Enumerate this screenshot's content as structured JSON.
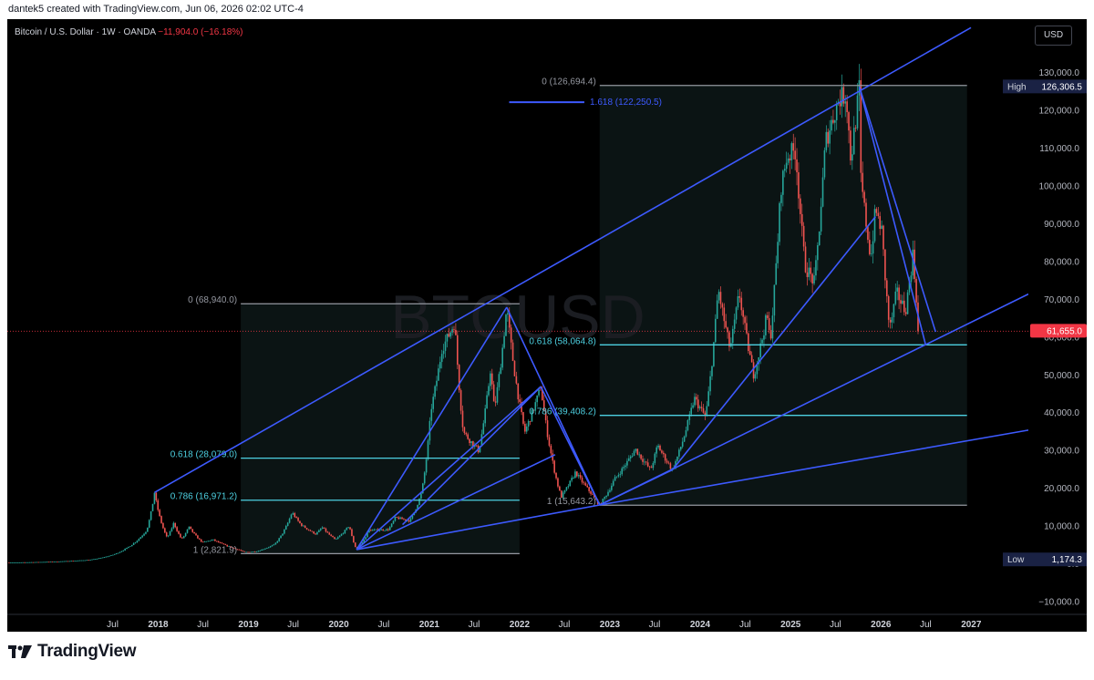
{
  "header": {
    "credit": "dantek5 created with TradingView.com, Jun 06, 2026 02:02 UTC-4"
  },
  "ticker": {
    "symbol": "Bitcoin / U.S. Dollar · 1W · OANDA",
    "change": "−11,904.0 (−16.18%)"
  },
  "currency_label": "USD",
  "watermark": "BTCUSD",
  "footer": {
    "logo_text": "TradingView",
    "logo_icon": "tradingview-logo-icon"
  },
  "colors": {
    "background": "#000000",
    "up": "#26a69a",
    "down": "#ef5350",
    "trendline": "#3d5afe",
    "fib_cyan": "#4dd0e1",
    "fib_gray": "#9598a1",
    "last_price": "#f23645"
  },
  "chart_data": {
    "type": "candlestick",
    "ylim": [
      -13000,
      137000
    ],
    "xlim": [
      "2016-05-01",
      "2027-08-20"
    ],
    "y_ticks": [
      -10000,
      0,
      10000,
      20000,
      30000,
      40000,
      50000,
      60000,
      70000,
      80000,
      90000,
      100000,
      110000,
      120000,
      130000
    ],
    "y_tick_labels": [
      "−10,000.0",
      "0.0",
      "10,000.0",
      "20,000.0",
      "30,000.0",
      "40,000.0",
      "50,000.0",
      "60,000.0",
      "70,000.0",
      "80,000.0",
      "90,000.0",
      "100,000.0",
      "110,000.0",
      "120,000.0",
      "130,000.0"
    ],
    "x_ticks": [
      {
        "date": "2017-07-01",
        "label": "Jul",
        "bold": false
      },
      {
        "date": "2018-01-01",
        "label": "2018",
        "bold": true
      },
      {
        "date": "2018-07-01",
        "label": "Jul",
        "bold": false
      },
      {
        "date": "2019-01-01",
        "label": "2019",
        "bold": true
      },
      {
        "date": "2019-07-01",
        "label": "Jul",
        "bold": false
      },
      {
        "date": "2020-01-01",
        "label": "2020",
        "bold": true
      },
      {
        "date": "2020-07-01",
        "label": "Jul",
        "bold": false
      },
      {
        "date": "2021-01-01",
        "label": "2021",
        "bold": true
      },
      {
        "date": "2021-07-01",
        "label": "Jul",
        "bold": false
      },
      {
        "date": "2022-01-01",
        "label": "2022",
        "bold": true
      },
      {
        "date": "2022-07-01",
        "label": "Jul",
        "bold": false
      },
      {
        "date": "2023-01-01",
        "label": "2023",
        "bold": true
      },
      {
        "date": "2023-07-01",
        "label": "Jul",
        "bold": false
      },
      {
        "date": "2024-01-01",
        "label": "2024",
        "bold": true
      },
      {
        "date": "2024-07-01",
        "label": "Jul",
        "bold": false
      },
      {
        "date": "2025-01-01",
        "label": "2025",
        "bold": true
      },
      {
        "date": "2025-07-01",
        "label": "Jul",
        "bold": false
      },
      {
        "date": "2026-01-01",
        "label": "2026",
        "bold": true
      },
      {
        "date": "2026-07-01",
        "label": "Jul",
        "bold": false
      },
      {
        "date": "2027-01-01",
        "label": "2027",
        "bold": true
      }
    ],
    "price_path": [
      [
        "2016-05-01",
        450
      ],
      [
        "2016-11-01",
        700
      ],
      [
        "2017-04-01",
        1200
      ],
      [
        "2017-07-01",
        2500
      ],
      [
        "2017-09-01",
        4500
      ],
      [
        "2017-11-15",
        9000
      ],
      [
        "2017-12-17",
        19000
      ],
      [
        "2018-02-06",
        7000
      ],
      [
        "2018-03-05",
        11000
      ],
      [
        "2018-04-06",
        6600
      ],
      [
        "2018-05-05",
        9900
      ],
      [
        "2018-06-29",
        5800
      ],
      [
        "2018-08-10",
        6500
      ],
      [
        "2018-11-25",
        3800
      ],
      [
        "2018-12-15",
        3200
      ],
      [
        "2019-02-01",
        3400
      ],
      [
        "2019-04-15",
        5200
      ],
      [
        "2019-06-26",
        13800
      ],
      [
        "2019-08-01",
        10500
      ],
      [
        "2019-09-30",
        8000
      ],
      [
        "2019-10-26",
        9800
      ],
      [
        "2019-12-18",
        6500
      ],
      [
        "2020-02-13",
        10300
      ],
      [
        "2020-03-13",
        3900
      ],
      [
        "2020-05-01",
        9000
      ],
      [
        "2020-07-20",
        9200
      ],
      [
        "2020-08-17",
        12400
      ],
      [
        "2020-10-15",
        11500
      ],
      [
        "2020-12-01",
        19000
      ],
      [
        "2021-01-08",
        41000
      ],
      [
        "2021-02-21",
        57000
      ],
      [
        "2021-04-14",
        64000
      ],
      [
        "2021-05-19",
        35000
      ],
      [
        "2021-07-20",
        30000
      ],
      [
        "2021-09-06",
        52000
      ],
      [
        "2021-09-21",
        41000
      ],
      [
        "2021-11-10",
        68000
      ],
      [
        "2022-01-22",
        35000
      ],
      [
        "2022-03-28",
        47000
      ],
      [
        "2022-05-12",
        28000
      ],
      [
        "2022-06-18",
        17800
      ],
      [
        "2022-08-15",
        24400
      ],
      [
        "2022-10-15",
        19000
      ],
      [
        "2022-11-21",
        15700
      ],
      [
        "2023-01-20",
        22500
      ],
      [
        "2023-04-14",
        30500
      ],
      [
        "2023-06-15",
        25000
      ],
      [
        "2023-07-13",
        31500
      ],
      [
        "2023-09-11",
        25000
      ],
      [
        "2023-12-08",
        44000
      ],
      [
        "2024-01-23",
        39000
      ],
      [
        "2024-03-14",
        73000
      ],
      [
        "2024-05-01",
        57000
      ],
      [
        "2024-06-07",
        71900
      ],
      [
        "2024-08-05",
        50000
      ],
      [
        "2024-09-27",
        66000
      ],
      [
        "2024-10-10",
        59000
      ],
      [
        "2024-11-22",
        99500
      ],
      [
        "2024-12-17",
        108000
      ],
      [
        "2025-01-21",
        109500
      ],
      [
        "2025-02-28",
        79000
      ],
      [
        "2025-04-07",
        74500
      ],
      [
        "2025-05-22",
        112000
      ],
      [
        "2025-07-14",
        123000
      ],
      [
        "2025-08-14",
        124500
      ],
      [
        "2025-09-01",
        107000
      ],
      [
        "2025-10-06",
        126300
      ],
      [
        "2025-10-10",
        103000
      ],
      [
        "2025-11-21",
        81000
      ],
      [
        "2025-12-10",
        94000
      ],
      [
        "2026-01-05",
        88000
      ],
      [
        "2026-02-05",
        62000
      ],
      [
        "2026-03-05",
        72000
      ],
      [
        "2026-04-10",
        67000
      ],
      [
        "2026-05-10",
        82000
      ],
      [
        "2026-06-06",
        61655
      ]
    ],
    "fib_levels": [
      {
        "label": "0 (68,940.0)",
        "price": 68940,
        "color": "gray",
        "from": "2018-12-01",
        "to": "2022-01-01",
        "label_side": "left"
      },
      {
        "label": "0.618 (28,079.0)",
        "price": 28079,
        "color": "cyan",
        "from": "2018-12-01",
        "to": "2022-01-01",
        "label_side": "left"
      },
      {
        "label": "0.786 (16,971.2)",
        "price": 16971,
        "color": "cyan",
        "from": "2018-12-01",
        "to": "2022-01-01",
        "label_side": "left"
      },
      {
        "label": "1 (2,821.9)",
        "price": 2822,
        "color": "gray",
        "from": "2018-12-01",
        "to": "2022-01-01",
        "label_side": "left"
      },
      {
        "label": "0 (126,694.4)",
        "price": 126694,
        "color": "gray",
        "from": "2022-11-21",
        "to": "2026-12-15",
        "label_side": "left"
      },
      {
        "label": "1.618 (122,250.5)",
        "price": 122250,
        "color": "blue",
        "from": "2021-11-20",
        "to": "2022-09-20",
        "label_side": "right"
      },
      {
        "label": "0.618 (58,064.8)",
        "price": 58065,
        "color": "cyan",
        "from": "2022-11-21",
        "to": "2026-12-15",
        "label_side": "left"
      },
      {
        "label": "0.786 (39,408.2)",
        "price": 39408,
        "color": "cyan",
        "from": "2022-11-21",
        "to": "2026-12-15",
        "label_side": "left"
      },
      {
        "label": "1 (15,643.2)",
        "price": 15643,
        "color": "gray",
        "from": "2022-11-21",
        "to": "2026-12-15",
        "label_side": "left"
      }
    ],
    "trendlines": [
      {
        "from": [
          "2017-12-17",
          19000
        ],
        "to": [
          "2026-12-31",
          142000
        ]
      },
      {
        "from": [
          "2020-03-13",
          3900
        ],
        "to": [
          "2021-11-10",
          68000
        ]
      },
      {
        "from": [
          "2020-03-13",
          3900
        ],
        "to": [
          "2022-11-21",
          15700
        ]
      },
      {
        "from": [
          "2020-03-13",
          3900
        ],
        "to": [
          "2022-05-25",
          29000
        ]
      },
      {
        "from": [
          "2020-03-13",
          3900
        ],
        "to": [
          "2022-03-28",
          47000
        ]
      },
      {
        "from": [
          "2020-09-15",
          10500
        ],
        "to": [
          "2022-03-28",
          47000
        ]
      },
      {
        "from": [
          "2021-11-10",
          68000
        ],
        "to": [
          "2022-11-21",
          15700
        ]
      },
      {
        "from": [
          "2022-03-28",
          47000
        ],
        "to": [
          "2022-11-21",
          15700
        ]
      },
      {
        "from": [
          "2022-11-21",
          15700
        ],
        "to": [
          "2023-09-11",
          25000
        ]
      },
      {
        "from": [
          "2023-09-11",
          25000
        ],
        "to": [
          "2025-12-10",
          92000
        ]
      },
      {
        "from": [
          "2022-11-21",
          15700
        ],
        "to": [
          "2027-08-20",
          71500
        ]
      },
      {
        "from": [
          "2022-11-21",
          15700
        ],
        "to": [
          "2027-08-20",
          35500
        ]
      },
      {
        "from": [
          "2025-10-06",
          126300
        ],
        "to": [
          "2026-07-01",
          58000
        ]
      },
      {
        "from": [
          "2025-10-06",
          126300
        ],
        "to": [
          "2026-08-10",
          61500
        ]
      }
    ],
    "shaded_regions": [
      {
        "from": "2018-12-01",
        "to": "2022-01-01",
        "top": 68940,
        "bottom": 2822
      },
      {
        "from": "2022-11-21",
        "to": "2026-12-15",
        "top": 126694,
        "bottom": 15643
      }
    ],
    "last_price": {
      "value": 61655,
      "label": "61,655.0"
    },
    "high": {
      "label": "High",
      "value_label": "126,306.5",
      "value": 126306
    },
    "low": {
      "label": "Low",
      "value_label": "1,174.3",
      "value": 1174
    }
  }
}
